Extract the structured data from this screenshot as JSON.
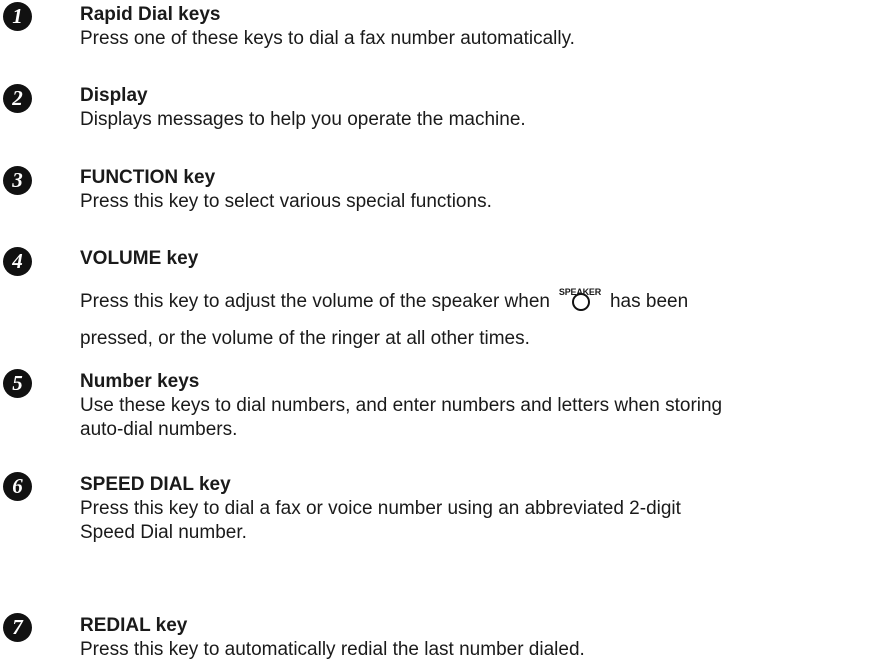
{
  "items": [
    {
      "number": "1",
      "title": "Rapid Dial keys",
      "lines": [
        "Press one of these keys to dial a fax number automatically."
      ]
    },
    {
      "number": "2",
      "title": "Display",
      "lines": [
        "Displays messages to help you operate the machine."
      ]
    },
    {
      "number": "3",
      "title": "FUNCTION key",
      "lines": [
        "Press this key to select various special functions."
      ]
    },
    {
      "number": "4",
      "title": "VOLUME key",
      "line1_before": "Press this key to adjust the volume of the speaker when",
      "speaker_label": "SPEAKER",
      "line1_after": "has been",
      "line2": "pressed, or the volume of the ringer at all other times."
    },
    {
      "number": "5",
      "title": "Number keys",
      "lines": [
        "Use these keys to dial numbers, and enter numbers and letters when storing",
        "auto-dial numbers."
      ]
    },
    {
      "number": "6",
      "title": "SPEED DIAL key",
      "lines": [
        "Press this key to dial a fax or voice number using an abbreviated 2-digit",
        "Speed Dial number."
      ]
    },
    {
      "number": "7",
      "title": "REDIAL key",
      "lines": [
        "Press this key to automatically redial the last number dialed."
      ]
    }
  ]
}
